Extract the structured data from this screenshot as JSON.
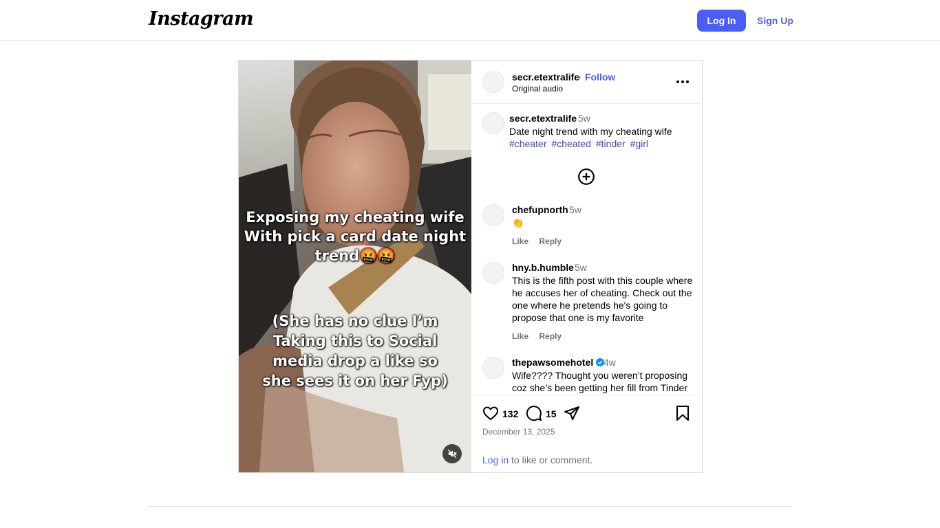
{
  "header": {
    "logo_text": "Instagram",
    "login_label": "Log In",
    "signup_label": "Sign Up"
  },
  "post": {
    "author": "secr.etextralife",
    "follow_label": "Follow",
    "separator": "•",
    "audio_label": "Original audio",
    "video_overlay": {
      "line1": "Exposing my cheating wife",
      "line2": "With pick a card date night",
      "line3": "trend🤬🤬",
      "line4": "(She has no clue I’m",
      "line5": "Taking this to Social",
      "line6": "media drop a like so",
      "line7": "she sees it on her Fyp)"
    },
    "caption": {
      "user": "secr.etextralife",
      "time": "5w",
      "text": "Date night trend with my cheating wife",
      "hashtags": [
        "#cheater",
        "#cheated",
        "#tinder",
        "#girl"
      ]
    },
    "comments": [
      {
        "user": "chefupnorth",
        "time": "5w",
        "text": "👏",
        "like_label": "Like",
        "reply_label": "Reply"
      },
      {
        "user": "hny.b.humble",
        "time": "5w",
        "text": "This is the fifth post with this couple where he accuses her of cheating. Check out the one where he pretends he's going to propose that one is my favorite",
        "like_label": "Like",
        "reply_label": "Reply"
      },
      {
        "user": "thepawsomehotel",
        "time": "4w",
        "verified": true,
        "text": "Wife???? Thought you weren’t proposing coz she’s been getting her fill from Tinder"
      }
    ],
    "likes_count": "132",
    "comments_count": "15",
    "date": "December 13, 2025",
    "login_prompt_link": "Log in",
    "login_prompt_rest": " to like or comment."
  },
  "icons": {
    "mute": "speaker-muted-icon",
    "more": "more-options-icon",
    "load_more": "plus-circle-icon",
    "like": "heart-icon",
    "comment": "comment-icon",
    "share": "send-icon",
    "save": "bookmark-icon",
    "verified": "verified-badge-icon"
  },
  "colors": {
    "accent": "#4a5df9",
    "hashtag": "#3949ab",
    "verified": "#0095f6",
    "muted_text": "#737373"
  }
}
